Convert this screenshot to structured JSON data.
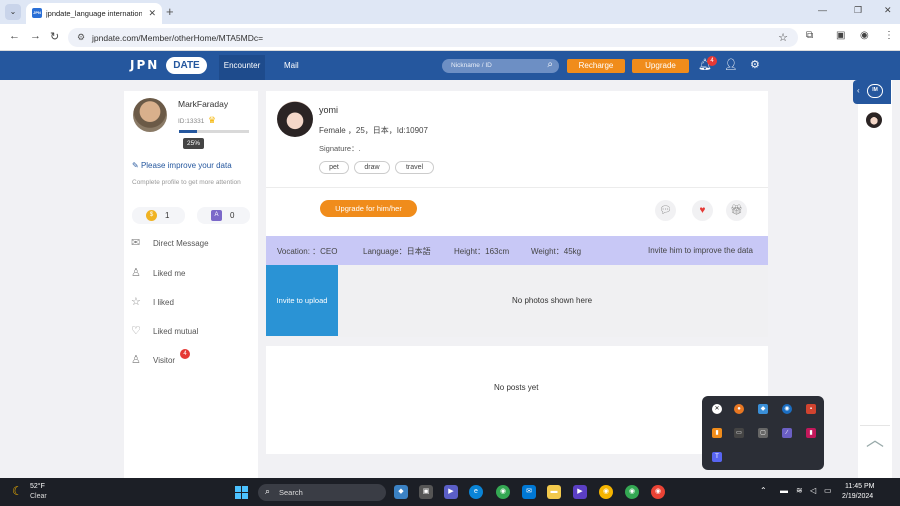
{
  "browser": {
    "tab_title": "jpndate_language internation",
    "tab_favicon": "JPN",
    "url": "jpndate.com/Member/otherHome/MTA5MDc="
  },
  "header": {
    "logo_jpn": "JPN",
    "logo_date": "DATE",
    "nav_encounter": "Encounter",
    "nav_mail": "Mail",
    "search_placeholder": "Nickname / ID",
    "recharge": "Recharge",
    "upgrade": "Upgrade",
    "notification_count": "4",
    "colors": {
      "primary": "#25579e",
      "accent": "#f08c1b"
    }
  },
  "me": {
    "name": "MarkFaraday",
    "id": "ID:13331",
    "progress_percent": 25,
    "progress_label": "25%",
    "improve_link": "Please improve your data",
    "improve_sub": "Complete profile to get more attention",
    "coins": "1",
    "points": "0"
  },
  "menu": {
    "direct_message": "Direct Message",
    "liked_me": "Liked me",
    "i_liked": "I liked",
    "liked_mutual": "Liked mutual",
    "visitor": "Visitor",
    "visitor_badge": "4"
  },
  "profile": {
    "name": "yomi",
    "info": "Female ，25，日本，Id:10907",
    "signature": "Signature：.",
    "tags": [
      "pet",
      "draw",
      "travel"
    ],
    "upgrade_button": "Upgrade for him/her"
  },
  "details": {
    "vocation": "Vocation: ：CEO",
    "language": "Language：日本語",
    "height": "Height：163cm",
    "weight": "Weight：45kg",
    "invite_link": "Invite him to improve the data"
  },
  "photos": {
    "invite_upload": "Invite to upload",
    "empty": "No photos shown here"
  },
  "posts": {
    "empty": "No posts yet"
  },
  "rail": {
    "chat_label": "IM"
  },
  "taskbar": {
    "temperature": "52°F",
    "condition": "Clear",
    "search": "Search",
    "time": "11:45 PM",
    "date": "2/19/2024"
  }
}
